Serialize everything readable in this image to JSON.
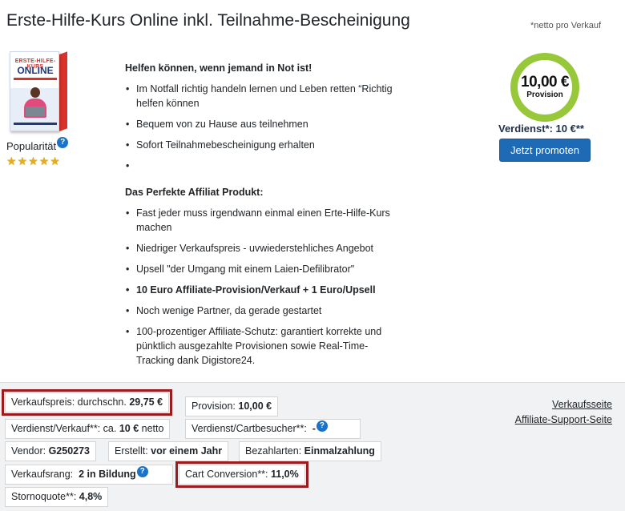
{
  "product": {
    "title": "Erste-Hilfe-Kurs Online inkl. Teilnahme-Bescheinigung",
    "netto_note": "*netto pro Verkauf",
    "box_line1": "ERSTE-HILFE-KURS",
    "box_line2": "ONLINE"
  },
  "popularity": {
    "label": "Popularität",
    "help": "?",
    "stars": [
      "★",
      "★",
      "★",
      "★",
      "★"
    ],
    "rating": 5
  },
  "description": {
    "heading1": "Helfen können, wenn jemand in Not ist!",
    "list1": [
      "Im Notfall richtig handeln lernen und Leben retten “Richtig helfen können",
      "Bequem von zu Hause aus teilnehmen",
      "Sofort Teilnahmebescheinigung erhalten",
      ""
    ],
    "heading2": "Das Perfekte Affiliat Produkt:",
    "list2": [
      "Fast jeder muss irgendwann einmal einen Erte-Hilfe-Kurs machen",
      "Niedriger Verkaufspreis - uvwiederstehliches Angebot",
      "Upsell \"der Umgang mit einem Laien-Defilibrator\"",
      "10 Euro Affiliate-Provision/Verkauf + 1 Euro/Upsell",
      "Noch wenige Partner, da gerade gestartet",
      "100-prozentiger Affiliate-Schutz: garantiert korrekte und pünktlich ausgezahlte Provisionen sowie Real-Time-Tracking dank Digistore24."
    ]
  },
  "commission": {
    "amount": "10,00 €",
    "label": "Provision",
    "earn": "Verdienst*: 10 €**",
    "button": "Jetzt promoten",
    "ring_color": "#96c83a",
    "button_color": "#1f6ab5"
  },
  "stats": {
    "price_label": "Verkaufspreis: durchschn.",
    "price_value": "29,75 €",
    "provision_label": "Provision:",
    "provision_value": "10,00 €",
    "earn_sale_label": "Verdienst/Verkauf**: ca.",
    "earn_sale_value": "10 €",
    "earn_sale_suffix": "netto",
    "earn_cart_label": "Verdienst/Cartbesucher**:",
    "earn_cart_value": "-",
    "vendor_label": "Vendor:",
    "vendor_value": "G250273",
    "created_label": "Erstellt:",
    "created_value": "vor einem Jahr",
    "payment_label": "Bezahlarten:",
    "payment_value": "Einmalzahlung",
    "rank_label": "Verkaufsrang:",
    "rank_value": "2 in Bildung",
    "conversion_label": "Cart Conversion**:",
    "conversion_value": "11,0%",
    "storno_label": "Stornoquote**:",
    "storno_value": "4,8%",
    "help": "?",
    "highlight_color": "#9c1b1f"
  },
  "links": {
    "sales_page": "Verkaufsseite",
    "support_page": "Affiliate-Support-Seite"
  }
}
